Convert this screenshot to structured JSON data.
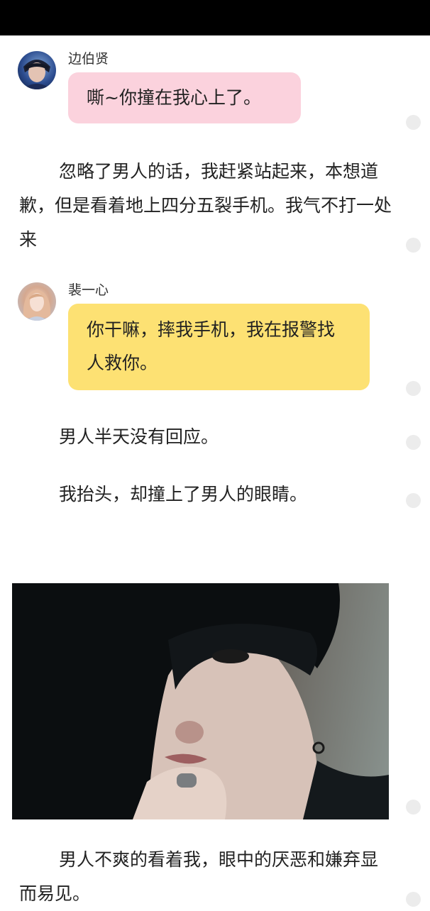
{
  "messages": [
    {
      "speaker": "边伯贤",
      "text": "嘶~你撞在我心上了。",
      "avatar_icon": "boy-avatar-icon",
      "bubble_color": "#fbd2dd"
    },
    {
      "speaker": "裴一心",
      "text": "你干嘛，摔我手机，我在报警找人救你。",
      "avatar_icon": "girl-avatar-icon",
      "bubble_color": "#fde173"
    }
  ],
  "paragraphs": [
    "忽略了男人的话，我赶紧站起来，本想道歉，但是看着地上四分五裂手机。我气不打一处来",
    "男人半天没有回应。",
    "我抬头，却撞上了男人的眼睛。",
    "男人不爽的看着我，眼中的厌恶和嫌弃显而易见。"
  ],
  "photo": {
    "icon": "man-portrait-photo"
  },
  "colors": {
    "status_bar": "#000000",
    "dot": "#ececec"
  }
}
